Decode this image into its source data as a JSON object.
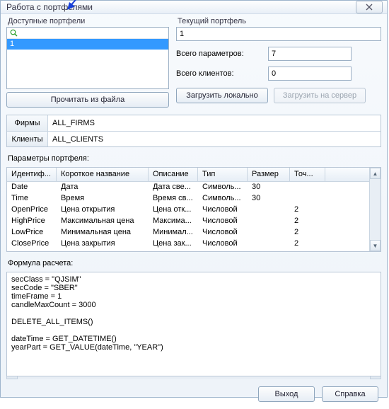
{
  "window": {
    "title": "Работа с портфелями"
  },
  "available": {
    "label": "Доступные портфели",
    "items": [
      "1"
    ],
    "read_from_file": "Прочитать из файла"
  },
  "current": {
    "label": "Текущий портфель",
    "value": "1",
    "params_label": "Всего параметров:",
    "params_value": "7",
    "clients_label": "Всего клиентов:",
    "clients_value": "0",
    "load_local": "Загрузить локально",
    "load_server": "Загрузить на сервер"
  },
  "tabs": {
    "firms_label": "Фирмы",
    "firms_value": "ALL_FIRMS",
    "clients_label": "Клиенты",
    "clients_value": "ALL_CLIENTS"
  },
  "params_table": {
    "label": "Параметры портфеля:",
    "headers": {
      "id": "Идентиф...",
      "short": "Короткое название",
      "desc": "Описание",
      "type": "Тип",
      "size": "Размер",
      "prec": "Точ..."
    },
    "rows": [
      {
        "id": "Date",
        "short": "Дата",
        "desc": "Дата све...",
        "type": "Символь...",
        "size": "30",
        "prec": ""
      },
      {
        "id": "Time",
        "short": "Время",
        "desc": "Время св...",
        "type": "Символь...",
        "size": "30",
        "prec": ""
      },
      {
        "id": "OpenPrice",
        "short": "Цена открытия",
        "desc": "Цена отк...",
        "type": "Числовой",
        "size": "",
        "prec": "2"
      },
      {
        "id": "HighPrice",
        "short": "Максимальная цена",
        "desc": "Максима...",
        "type": "Числовой",
        "size": "",
        "prec": "2"
      },
      {
        "id": "LowPrice",
        "short": "Минимальная цена",
        "desc": "Минимал...",
        "type": "Числовой",
        "size": "",
        "prec": "2"
      },
      {
        "id": "ClosePrice",
        "short": "Цена закрытия",
        "desc": "Цена зак...",
        "type": "Числовой",
        "size": "",
        "prec": "2"
      }
    ]
  },
  "formula": {
    "label": "Формула расчета:",
    "text": "secClass = \"QJSIM\"\nsecCode = \"SBER\"\ntimeFrame = 1\ncandleMaxCount = 3000\n\nDELETE_ALL_ITEMS()\n\ndateTime = GET_DATETIME()\nyearPart = GET_VALUE(dateTime, \"YEAR\")"
  },
  "footer": {
    "exit": "Выход",
    "help": "Справка"
  }
}
